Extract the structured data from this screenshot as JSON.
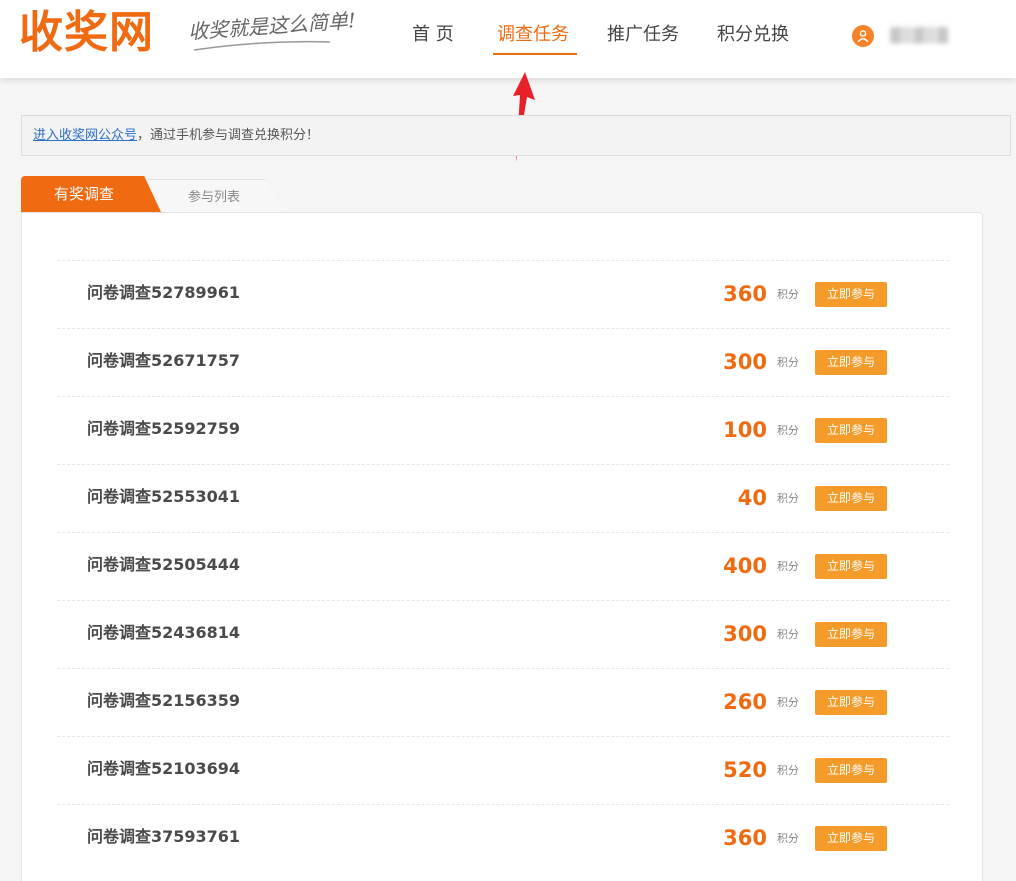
{
  "brand": {
    "logo_text": "收奖网",
    "slogan": "收奖就是这么简单!",
    "accent_color": "#f06a12",
    "button_color": "#f59b2a",
    "link_color": "#2c6fc9"
  },
  "nav": {
    "items": [
      {
        "label": "首 页",
        "active": false
      },
      {
        "label": "调查任务",
        "active": true
      },
      {
        "label": "推广任务",
        "active": false
      },
      {
        "label": "积分兑换",
        "active": false
      }
    ],
    "user_icon": "user-icon",
    "username": "▓▒▓▒▓"
  },
  "notice": {
    "link_text": "进入收奖网公众号",
    "text": "，通过手机参与调查兑换积分！"
  },
  "tabs": [
    {
      "label": "有奖调查",
      "active": true
    },
    {
      "label": "参与列表",
      "active": false
    }
  ],
  "surveys": [
    {
      "title": "问卷调查52789961",
      "points": "360",
      "unit": "积分",
      "button": "立即参与"
    },
    {
      "title": "问卷调查52671757",
      "points": "300",
      "unit": "积分",
      "button": "立即参与"
    },
    {
      "title": "问卷调查52592759",
      "points": "100",
      "unit": "积分",
      "button": "立即参与"
    },
    {
      "title": "问卷调查52553041",
      "points": "40",
      "unit": "积分",
      "button": "立即参与"
    },
    {
      "title": "问卷调查52505444",
      "points": "400",
      "unit": "积分",
      "button": "立即参与"
    },
    {
      "title": "问卷调查52436814",
      "points": "300",
      "unit": "积分",
      "button": "立即参与"
    },
    {
      "title": "问卷调查52156359",
      "points": "260",
      "unit": "积分",
      "button": "立即参与"
    },
    {
      "title": "问卷调查52103694",
      "points": "520",
      "unit": "积分",
      "button": "立即参与"
    },
    {
      "title": "问卷调查37593761",
      "points": "360",
      "unit": "积分",
      "button": "立即参与"
    }
  ]
}
